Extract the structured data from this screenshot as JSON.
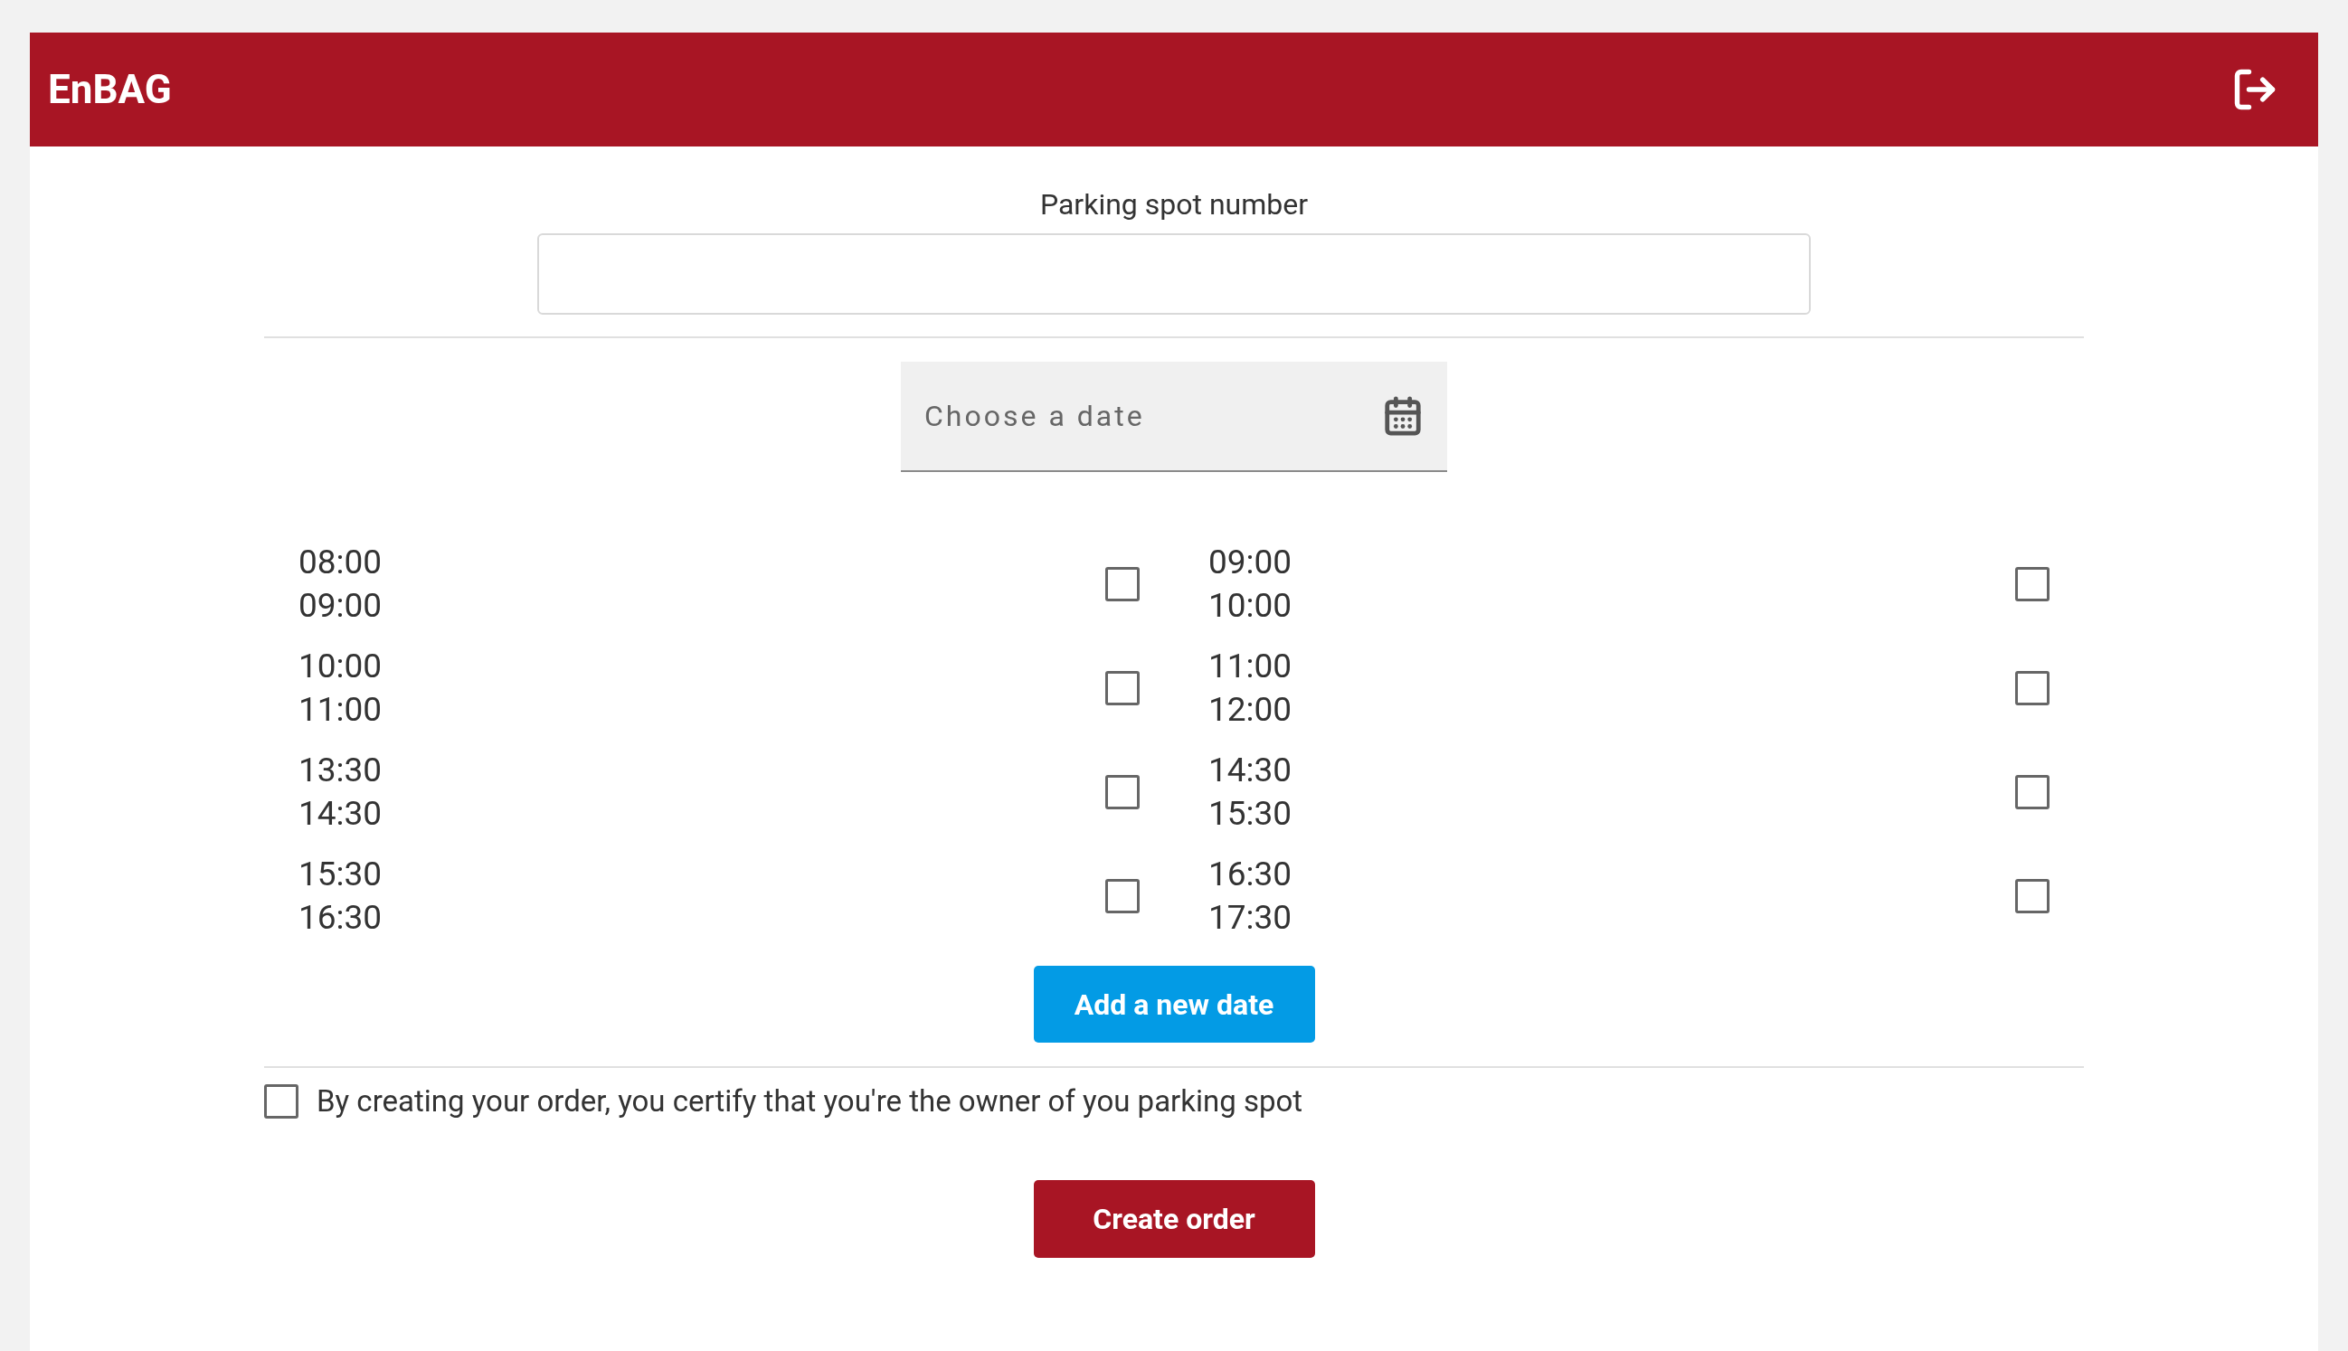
{
  "header": {
    "title": "EnBAG"
  },
  "parking_spot": {
    "label": "Parking spot number"
  },
  "date_field": {
    "placeholder": "Choose a date"
  },
  "slots": [
    {
      "start": "08:00",
      "end": "09:00",
      "checked": false
    },
    {
      "start": "09:00",
      "end": "10:00",
      "checked": false
    },
    {
      "start": "10:00",
      "end": "11:00",
      "checked": false
    },
    {
      "start": "11:00",
      "end": "12:00",
      "checked": false
    },
    {
      "start": "13:30",
      "end": "14:30",
      "checked": false
    },
    {
      "start": "14:30",
      "end": "15:30",
      "checked": false
    },
    {
      "start": "15:30",
      "end": "16:30",
      "checked": false
    },
    {
      "start": "16:30",
      "end": "17:30",
      "checked": false
    }
  ],
  "add_date_button": "Add a new date",
  "consent": {
    "text": "By creating your order, you certify that you're the owner of you parking spot",
    "checked": false
  },
  "create_button": "Create order"
}
